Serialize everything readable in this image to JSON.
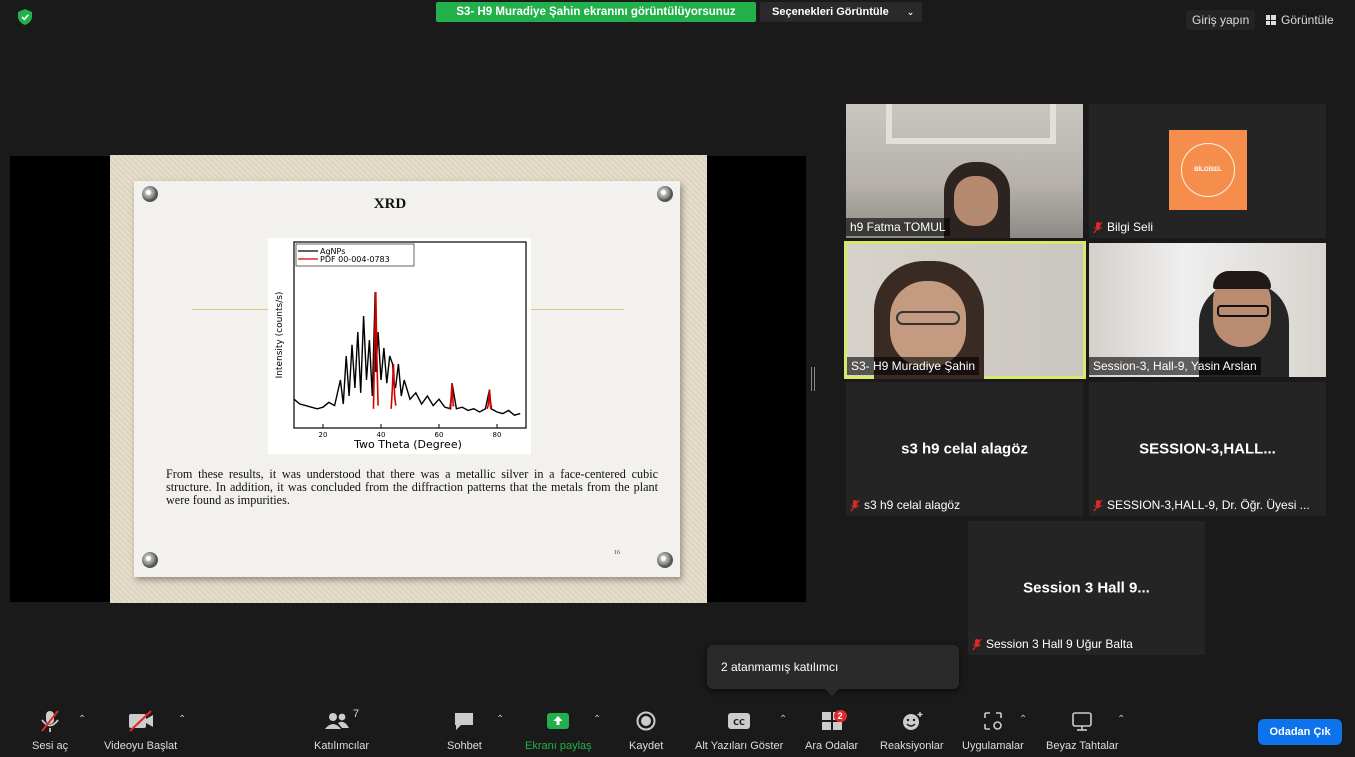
{
  "top": {
    "share_banner": "S3- H9 Muradiye Şahin ekranını görüntülüyorsunuz",
    "view_options": "Seçenekleri Görüntüle",
    "login": "Giriş yapın",
    "view": "Görüntüle"
  },
  "slide": {
    "title": "XRD",
    "body": "From these results, it was understood that there was a metallic silver in a face-centered cubic structure. In addition, it was concluded from the diffraction patterns that the metals from the plant were found as impurities.",
    "page_number": "16"
  },
  "chart_data": {
    "type": "line",
    "title": "",
    "xlabel": "Two Theta (Degree)",
    "ylabel": "Intensity (counts/s)",
    "xlim": [
      10,
      90
    ],
    "xticks": [
      20,
      40,
      60,
      80
    ],
    "legend_position": "top-left",
    "series": [
      {
        "name": "AgNPs",
        "color": "#000000",
        "x": [
          10,
          12,
          14,
          16,
          18,
          20,
          22,
          24,
          26,
          27,
          28,
          29,
          30,
          31,
          32,
          33,
          34,
          35,
          36,
          37,
          38,
          38.2,
          39,
          40,
          41,
          42,
          43,
          44,
          44.3,
          45,
          46,
          47,
          48,
          50,
          52,
          54,
          56,
          58,
          60,
          62,
          64,
          64.5,
          66,
          68,
          70,
          72,
          74,
          76,
          77.4,
          78,
          80,
          82,
          84,
          86,
          88
        ],
        "y": [
          18,
          15,
          14,
          13,
          12,
          13,
          16,
          14,
          30,
          15,
          45,
          20,
          52,
          25,
          60,
          22,
          70,
          30,
          55,
          20,
          85,
          35,
          60,
          30,
          50,
          28,
          45,
          40,
          30,
          25,
          40,
          20,
          30,
          18,
          22,
          15,
          20,
          14,
          18,
          13,
          12,
          28,
          12,
          13,
          11,
          12,
          10,
          12,
          24,
          12,
          10,
          9,
          11,
          8,
          9
        ]
      },
      {
        "name": "PDF 00-004-0783",
        "color": "#d40000",
        "x": [
          38.2,
          44.3,
          64.5,
          77.4
        ],
        "y": [
          85,
          40,
          28,
          24
        ]
      }
    ]
  },
  "participants": [
    {
      "name": "h9 Fatma TOMUL",
      "muted": false,
      "video": true
    },
    {
      "name": "Bilgi Seli",
      "muted": true,
      "video": false,
      "logo_text": "BİLGİSEL"
    },
    {
      "name": "S3- H9 Muradiye Şahin",
      "muted": false,
      "video": true,
      "speaking": true
    },
    {
      "name": "Session-3, Hall-9, Yasin Arslan",
      "muted": false,
      "video": true
    },
    {
      "name": "s3 h9 celal alagöz",
      "muted": true,
      "video": false,
      "display": "s3 h9 celal alagöz"
    },
    {
      "name": "SESSION-3,HALL-9, Dr. Öğr. Üyesi ...",
      "muted": true,
      "video": false,
      "display": "SESSION-3,HALL..."
    },
    {
      "name": "Session 3 Hall 9 Uğur Balta",
      "muted": true,
      "video": false,
      "display": "Session 3 Hall 9..."
    }
  ],
  "tooltip": "2 atanmamış katılımcı",
  "toolbar": {
    "unmute": "Sesi aç",
    "start_video": "Videoyu Başlat",
    "participants": "Katılımcılar",
    "participants_count": "7",
    "chat": "Sohbet",
    "share": "Ekranı paylaş",
    "record": "Kaydet",
    "captions": "Alt Yazıları Göster",
    "breakout": "Ara Odalar",
    "breakout_badge": "2",
    "reactions": "Reaksiyonlar",
    "apps": "Uygulamalar",
    "whiteboard": "Beyaz Tahtalar",
    "leave": "Odadan Çık"
  },
  "colors": {
    "share_green": "#22b04a",
    "leave_blue": "#0e72ed",
    "speaker_outline": "#d7e86a",
    "muted_red": "#e02828"
  }
}
